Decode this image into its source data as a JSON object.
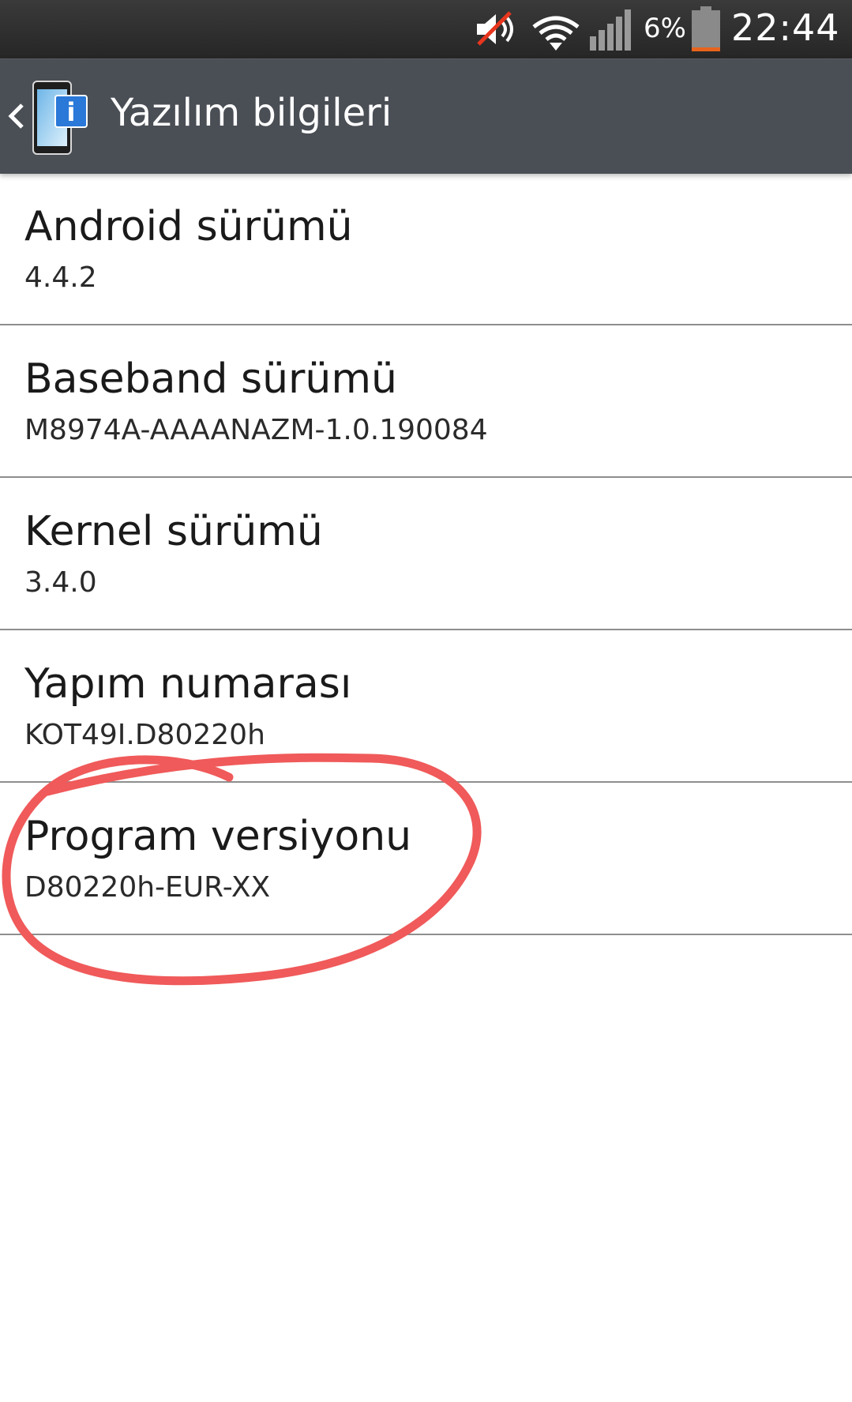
{
  "status_bar": {
    "battery_percent": "6%",
    "time": "22:44",
    "icons": [
      "sound-muted-icon",
      "wifi-icon",
      "signal-icon",
      "battery-icon"
    ],
    "battery_level": 0.06,
    "battery_color": "#e8641e"
  },
  "action_bar": {
    "title": "Yazılım bilgileri",
    "icon": "software-info-icon",
    "background": "#4a4e55"
  },
  "items": [
    {
      "title": "Android sürümü",
      "value": "4.4.2"
    },
    {
      "title": "Baseband sürümü",
      "value": "M8974A-AAAANAZM-1.0.190084"
    },
    {
      "title": "Kernel sürümü",
      "value": "3.4.0"
    },
    {
      "title": "Yapım numarası",
      "value": "KOT49I.D80220h"
    },
    {
      "title": "Program versiyonu",
      "value": "D80220h-EUR-XX"
    }
  ],
  "annotation": {
    "color": "#f05a5a",
    "target": "Program versiyonu"
  }
}
